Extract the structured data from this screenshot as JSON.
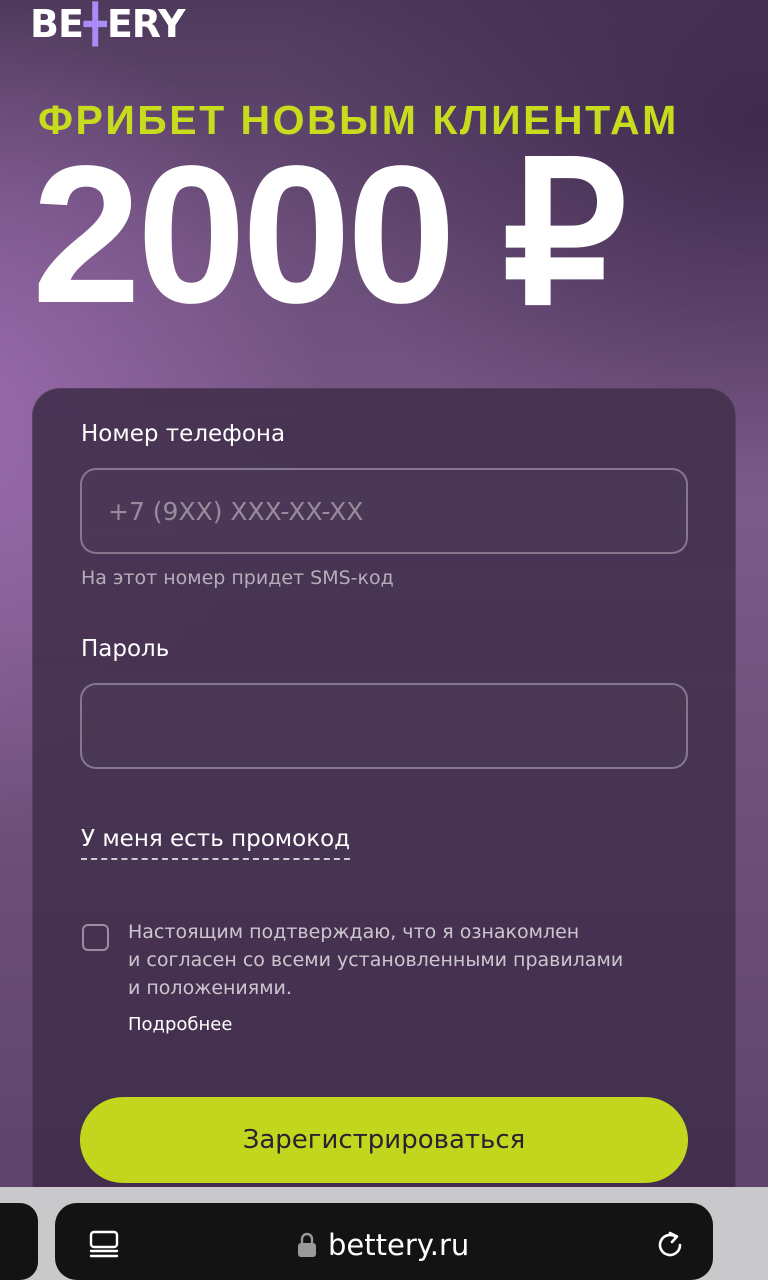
{
  "brand": {
    "logo_left": "BE",
    "logo_mark": "╋",
    "logo_right": "ERY"
  },
  "promo_header": {
    "headline": "ФРИБЕТ НОВЫМ КЛИЕНТАМ",
    "amount": "2000 ₽"
  },
  "form": {
    "phone_label": "Номер телефона",
    "phone_placeholder": "+7 (9XX) XXX-XX-XX",
    "phone_hint": "На этот номер придет SMS-код",
    "password_label": "Пароль",
    "password_value": "",
    "promo_link": "У меня есть промокод",
    "consent_lines": [
      "Настоящим подтверждаю, что я ознакомлен",
      "и согласен со всеми установленными правилами",
      "и положениями."
    ],
    "more_link": "Подробнее",
    "submit_label": "Зарегистрироваться"
  },
  "browser": {
    "url": "bettery.ru",
    "icons": [
      "tabs-icon",
      "lock-icon",
      "reload-icon"
    ]
  },
  "colors": {
    "accent": "#c3d61e",
    "headline": "#c8dc1e",
    "logo_mark": "#a98cf6"
  }
}
